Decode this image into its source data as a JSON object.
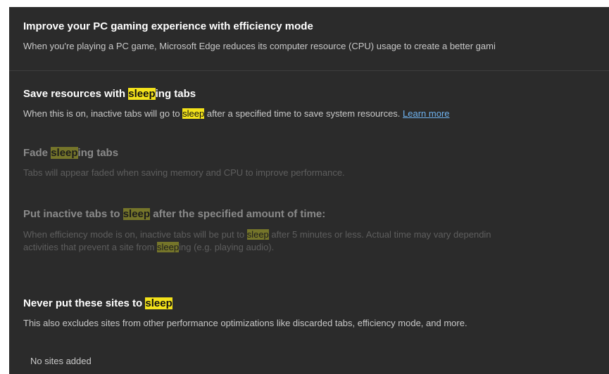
{
  "efficiency": {
    "title": "Improve your PC gaming experience with efficiency mode",
    "description": "When you're playing a PC game, Microsoft Edge reduces its computer resource (CPU) usage to create a better gami"
  },
  "sleeping_tabs": {
    "title_pre": "Save resources with ",
    "title_hl": "sleep",
    "title_hl_inner": "ing",
    "title_post": " tabs",
    "desc_pre": "When this is on, inactive tabs will go to ",
    "desc_hl": "sleep",
    "desc_post": " after a specified time to save system resources. ",
    "learn_more": "Learn more"
  },
  "fade": {
    "title_pre": "Fade ",
    "title_hl": "sleep",
    "title_post": "ing tabs",
    "description": "Tabs will appear faded when saving memory and CPU to improve performance."
  },
  "inactive": {
    "title_pre": "Put inactive tabs to ",
    "title_hl": "sleep",
    "title_post": " after the specified amount of time:",
    "desc1_pre": "When efficiency mode is on, inactive tabs will be put to ",
    "desc1_hl": "sleep",
    "desc1_post": " after 5 minutes or less. Actual time may vary dependin",
    "desc2_pre": "activities that prevent a site from ",
    "desc2_hl": "sleep",
    "desc2_post": "ing (e.g. playing audio)."
  },
  "never_sleep": {
    "title_pre": "Never put these sites to ",
    "title_hl": "sleep",
    "description": "This also excludes sites from other performance optimizations like discarded tabs, efficiency mode, and more.",
    "empty": "No sites added"
  }
}
